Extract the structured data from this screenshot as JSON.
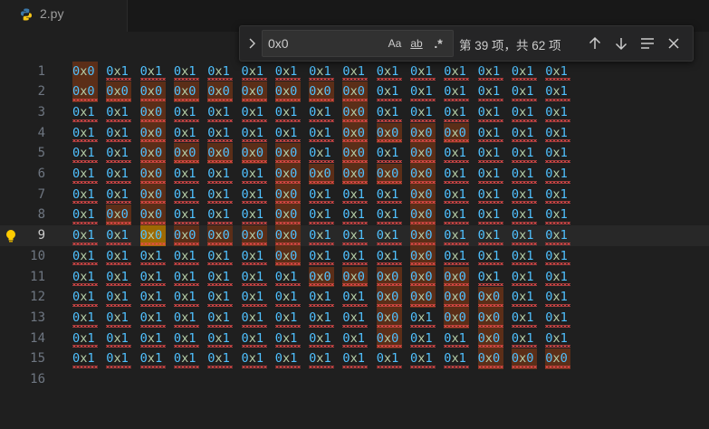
{
  "tab": {
    "filename": "2.py",
    "icon": "python-icon"
  },
  "find_widget": {
    "query": "0x0",
    "match_case_label": "Aa",
    "whole_word_label": "ab",
    "regex_label": ".*",
    "result_text": "第 39 项，共 62 项"
  },
  "editor": {
    "current_line": 9,
    "line_numbers": [
      "1",
      "2",
      "3",
      "4",
      "5",
      "6",
      "7",
      "8",
      "9",
      "10",
      "11",
      "12",
      "13",
      "14",
      "15",
      "16"
    ],
    "rows": [
      [
        "0x0",
        "0x1",
        "0x1",
        "0x1",
        "0x1",
        "0x1",
        "0x1",
        "0x1",
        "0x1",
        "0x1",
        "0x1",
        "0x1",
        "0x1",
        "0x1",
        "0x1"
      ],
      [
        "0x0",
        "0x0",
        "0x0",
        "0x0",
        "0x0",
        "0x0",
        "0x0",
        "0x0",
        "0x0",
        "0x1",
        "0x1",
        "0x1",
        "0x1",
        "0x1",
        "0x1"
      ],
      [
        "0x1",
        "0x1",
        "0x0",
        "0x1",
        "0x1",
        "0x1",
        "0x1",
        "0x1",
        "0x0",
        "0x1",
        "0x1",
        "0x1",
        "0x1",
        "0x1",
        "0x1"
      ],
      [
        "0x1",
        "0x1",
        "0x0",
        "0x1",
        "0x1",
        "0x1",
        "0x1",
        "0x1",
        "0x0",
        "0x0",
        "0x0",
        "0x0",
        "0x1",
        "0x1",
        "0x1"
      ],
      [
        "0x1",
        "0x1",
        "0x0",
        "0x0",
        "0x0",
        "0x0",
        "0x0",
        "0x1",
        "0x0",
        "0x1",
        "0x0",
        "0x1",
        "0x1",
        "0x1",
        "0x1"
      ],
      [
        "0x1",
        "0x1",
        "0x0",
        "0x1",
        "0x1",
        "0x1",
        "0x0",
        "0x0",
        "0x0",
        "0x0",
        "0x0",
        "0x1",
        "0x1",
        "0x1",
        "0x1"
      ],
      [
        "0x1",
        "0x1",
        "0x0",
        "0x1",
        "0x1",
        "0x1",
        "0x0",
        "0x1",
        "0x1",
        "0x1",
        "0x0",
        "0x1",
        "0x1",
        "0x1",
        "0x1"
      ],
      [
        "0x1",
        "0x0",
        "0x0",
        "0x1",
        "0x1",
        "0x1",
        "0x0",
        "0x1",
        "0x1",
        "0x1",
        "0x0",
        "0x1",
        "0x1",
        "0x1",
        "0x1"
      ],
      [
        "0x1",
        "0x1",
        "0x0",
        "0x0",
        "0x0",
        "0x0",
        "0x0",
        "0x1",
        "0x1",
        "0x1",
        "0x0",
        "0x1",
        "0x1",
        "0x1",
        "0x1"
      ],
      [
        "0x1",
        "0x1",
        "0x1",
        "0x1",
        "0x1",
        "0x1",
        "0x0",
        "0x1",
        "0x1",
        "0x1",
        "0x0",
        "0x1",
        "0x1",
        "0x1",
        "0x1"
      ],
      [
        "0x1",
        "0x1",
        "0x1",
        "0x1",
        "0x1",
        "0x1",
        "0x1",
        "0x0",
        "0x0",
        "0x0",
        "0x0",
        "0x0",
        "0x1",
        "0x1",
        "0x1"
      ],
      [
        "0x1",
        "0x1",
        "0x1",
        "0x1",
        "0x1",
        "0x1",
        "0x1",
        "0x1",
        "0x1",
        "0x0",
        "0x0",
        "0x0",
        "0x0",
        "0x1",
        "0x1"
      ],
      [
        "0x1",
        "0x1",
        "0x1",
        "0x1",
        "0x1",
        "0x1",
        "0x1",
        "0x1",
        "0x1",
        "0x0",
        "0x1",
        "0x0",
        "0x0",
        "0x1",
        "0x1"
      ],
      [
        "0x1",
        "0x1",
        "0x1",
        "0x1",
        "0x1",
        "0x1",
        "0x1",
        "0x1",
        "0x1",
        "0x0",
        "0x1",
        "0x1",
        "0x0",
        "0x1",
        "0x1"
      ],
      [
        "0x1",
        "0x1",
        "0x1",
        "0x1",
        "0x1",
        "0x1",
        "0x1",
        "0x1",
        "0x1",
        "0x1",
        "0x1",
        "0x1",
        "0x0",
        "0x0",
        "0x0"
      ],
      []
    ],
    "active_match": {
      "line": 9,
      "col": 2
    },
    "colors": {
      "number": "#4fc1ff",
      "hex_x": "#b5cea8",
      "match_bg": "#5b2e18",
      "active_match_bg": "#9e6a03",
      "squiggle": "#f14c4c"
    }
  }
}
